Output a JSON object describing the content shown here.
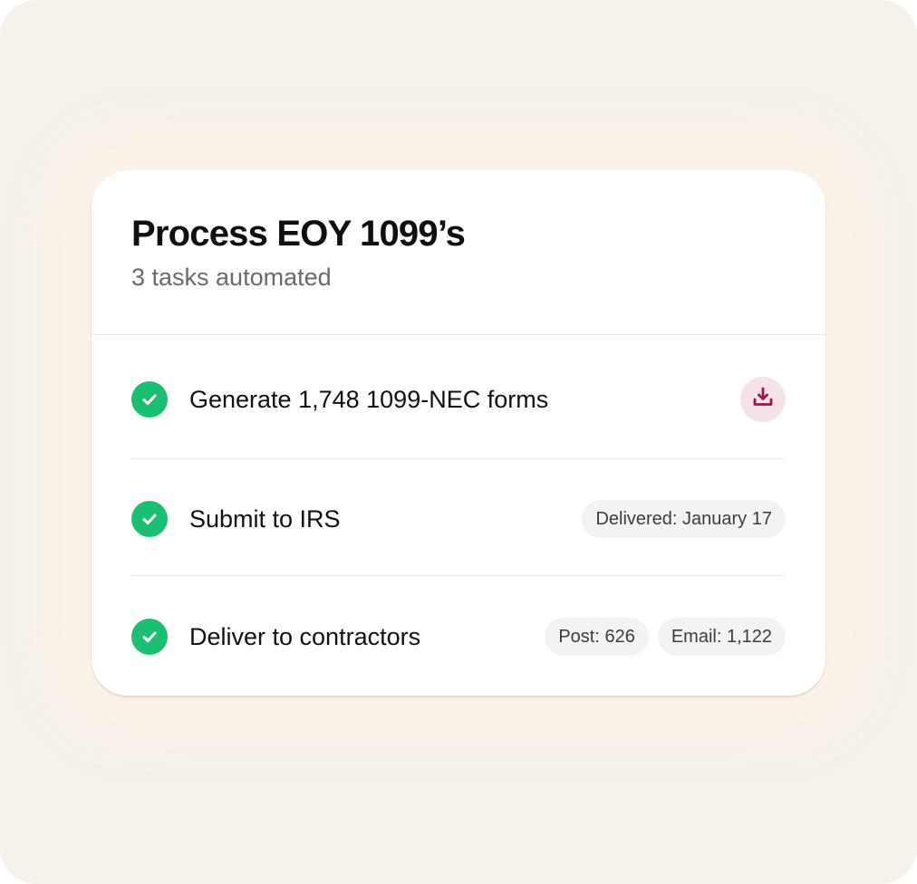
{
  "card": {
    "title": "Process EOY 1099’s",
    "subtitle": "3 tasks automated"
  },
  "tasks": [
    {
      "label": "Generate 1,748 1099-NEC forms",
      "status_icon": "check-circle-icon",
      "action_icon": "download-icon"
    },
    {
      "label": "Submit to IRS",
      "status_icon": "check-circle-icon",
      "pills": [
        "Delivered: January 17"
      ]
    },
    {
      "label": "Deliver to contractors",
      "status_icon": "check-circle-icon",
      "pills": [
        "Post: 626",
        "Email: 1,122"
      ]
    }
  ],
  "colors": {
    "background": "#f6f1ea",
    "card": "#ffffff",
    "check": "#1bbf73",
    "download_bg": "#f6e3ea",
    "download_icon": "#a3124d",
    "pill_bg": "#f3f3f3"
  }
}
